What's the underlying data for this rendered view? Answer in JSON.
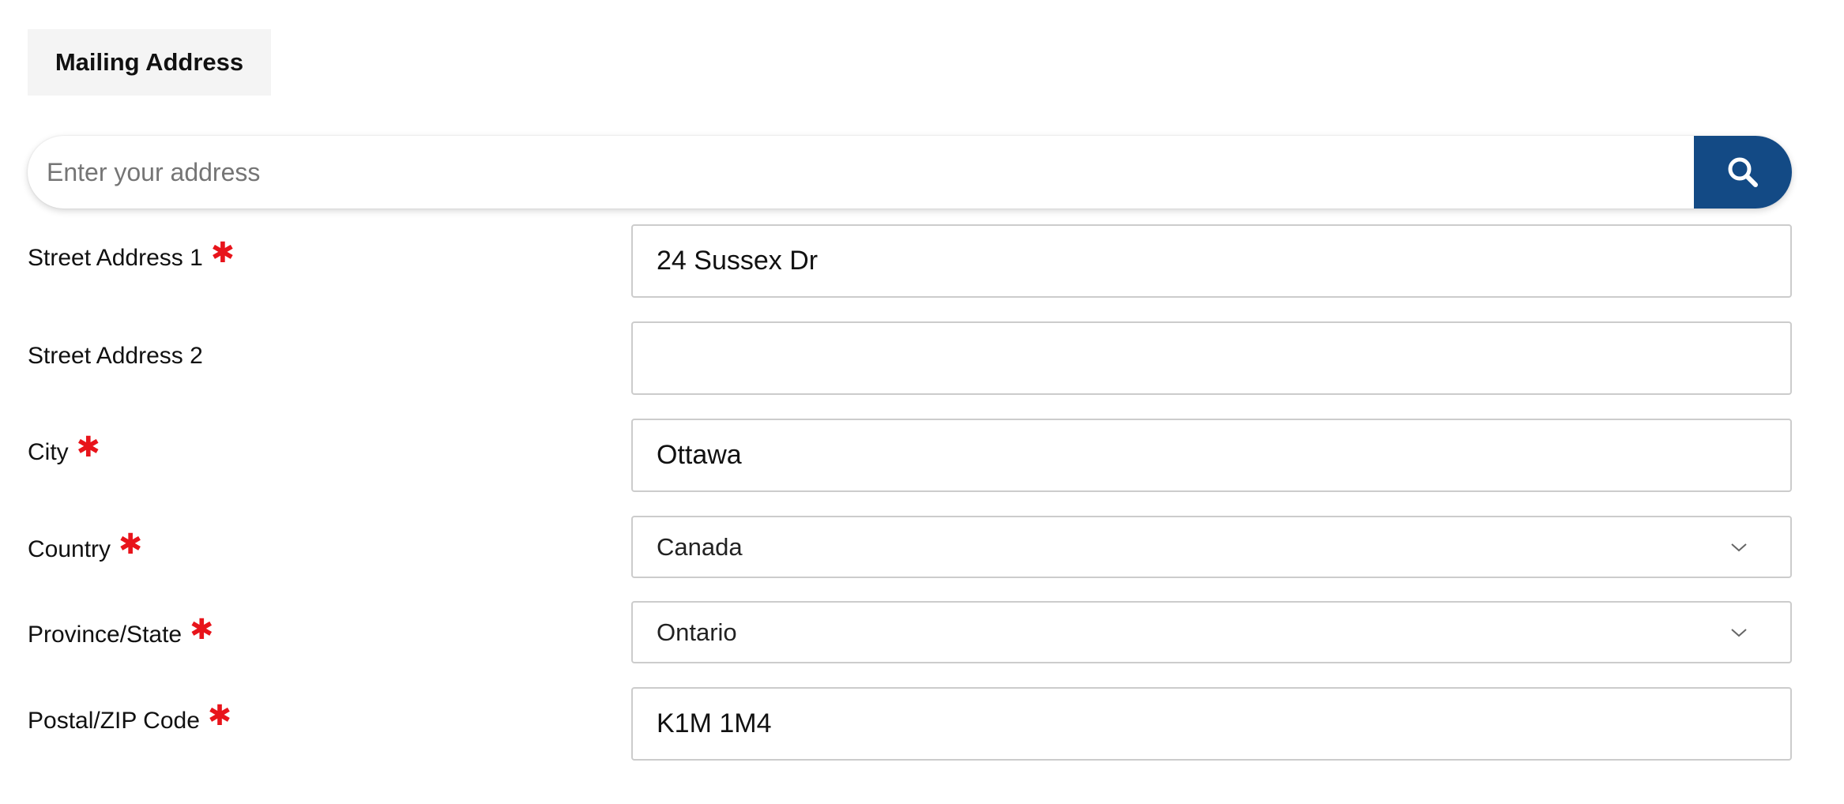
{
  "section": {
    "title": "Mailing Address"
  },
  "search": {
    "placeholder": "Enter your address",
    "value": "",
    "button_icon": "search-icon"
  },
  "form": {
    "street1": {
      "label": "Street Address 1",
      "required_mark": "✱",
      "value": "24 Sussex Dr"
    },
    "street2": {
      "label": "Street Address 2",
      "value": ""
    },
    "city": {
      "label": "City",
      "required_mark": "✱",
      "value": "Ottawa"
    },
    "country": {
      "label": "Country",
      "required_mark": "✱",
      "value": "Canada",
      "icon": "chevron-down-icon"
    },
    "province": {
      "label": "Province/State",
      "required_mark": "✱",
      "value": "Ontario",
      "icon": "chevron-down-icon"
    },
    "postal": {
      "label": "Postal/ZIP Code",
      "required_mark": "✱",
      "value": "K1M 1M4"
    }
  },
  "colors": {
    "accent": "#134a85",
    "required": "#e8141b",
    "border": "#cccccc",
    "tab_bg": "#f4f4f4"
  }
}
